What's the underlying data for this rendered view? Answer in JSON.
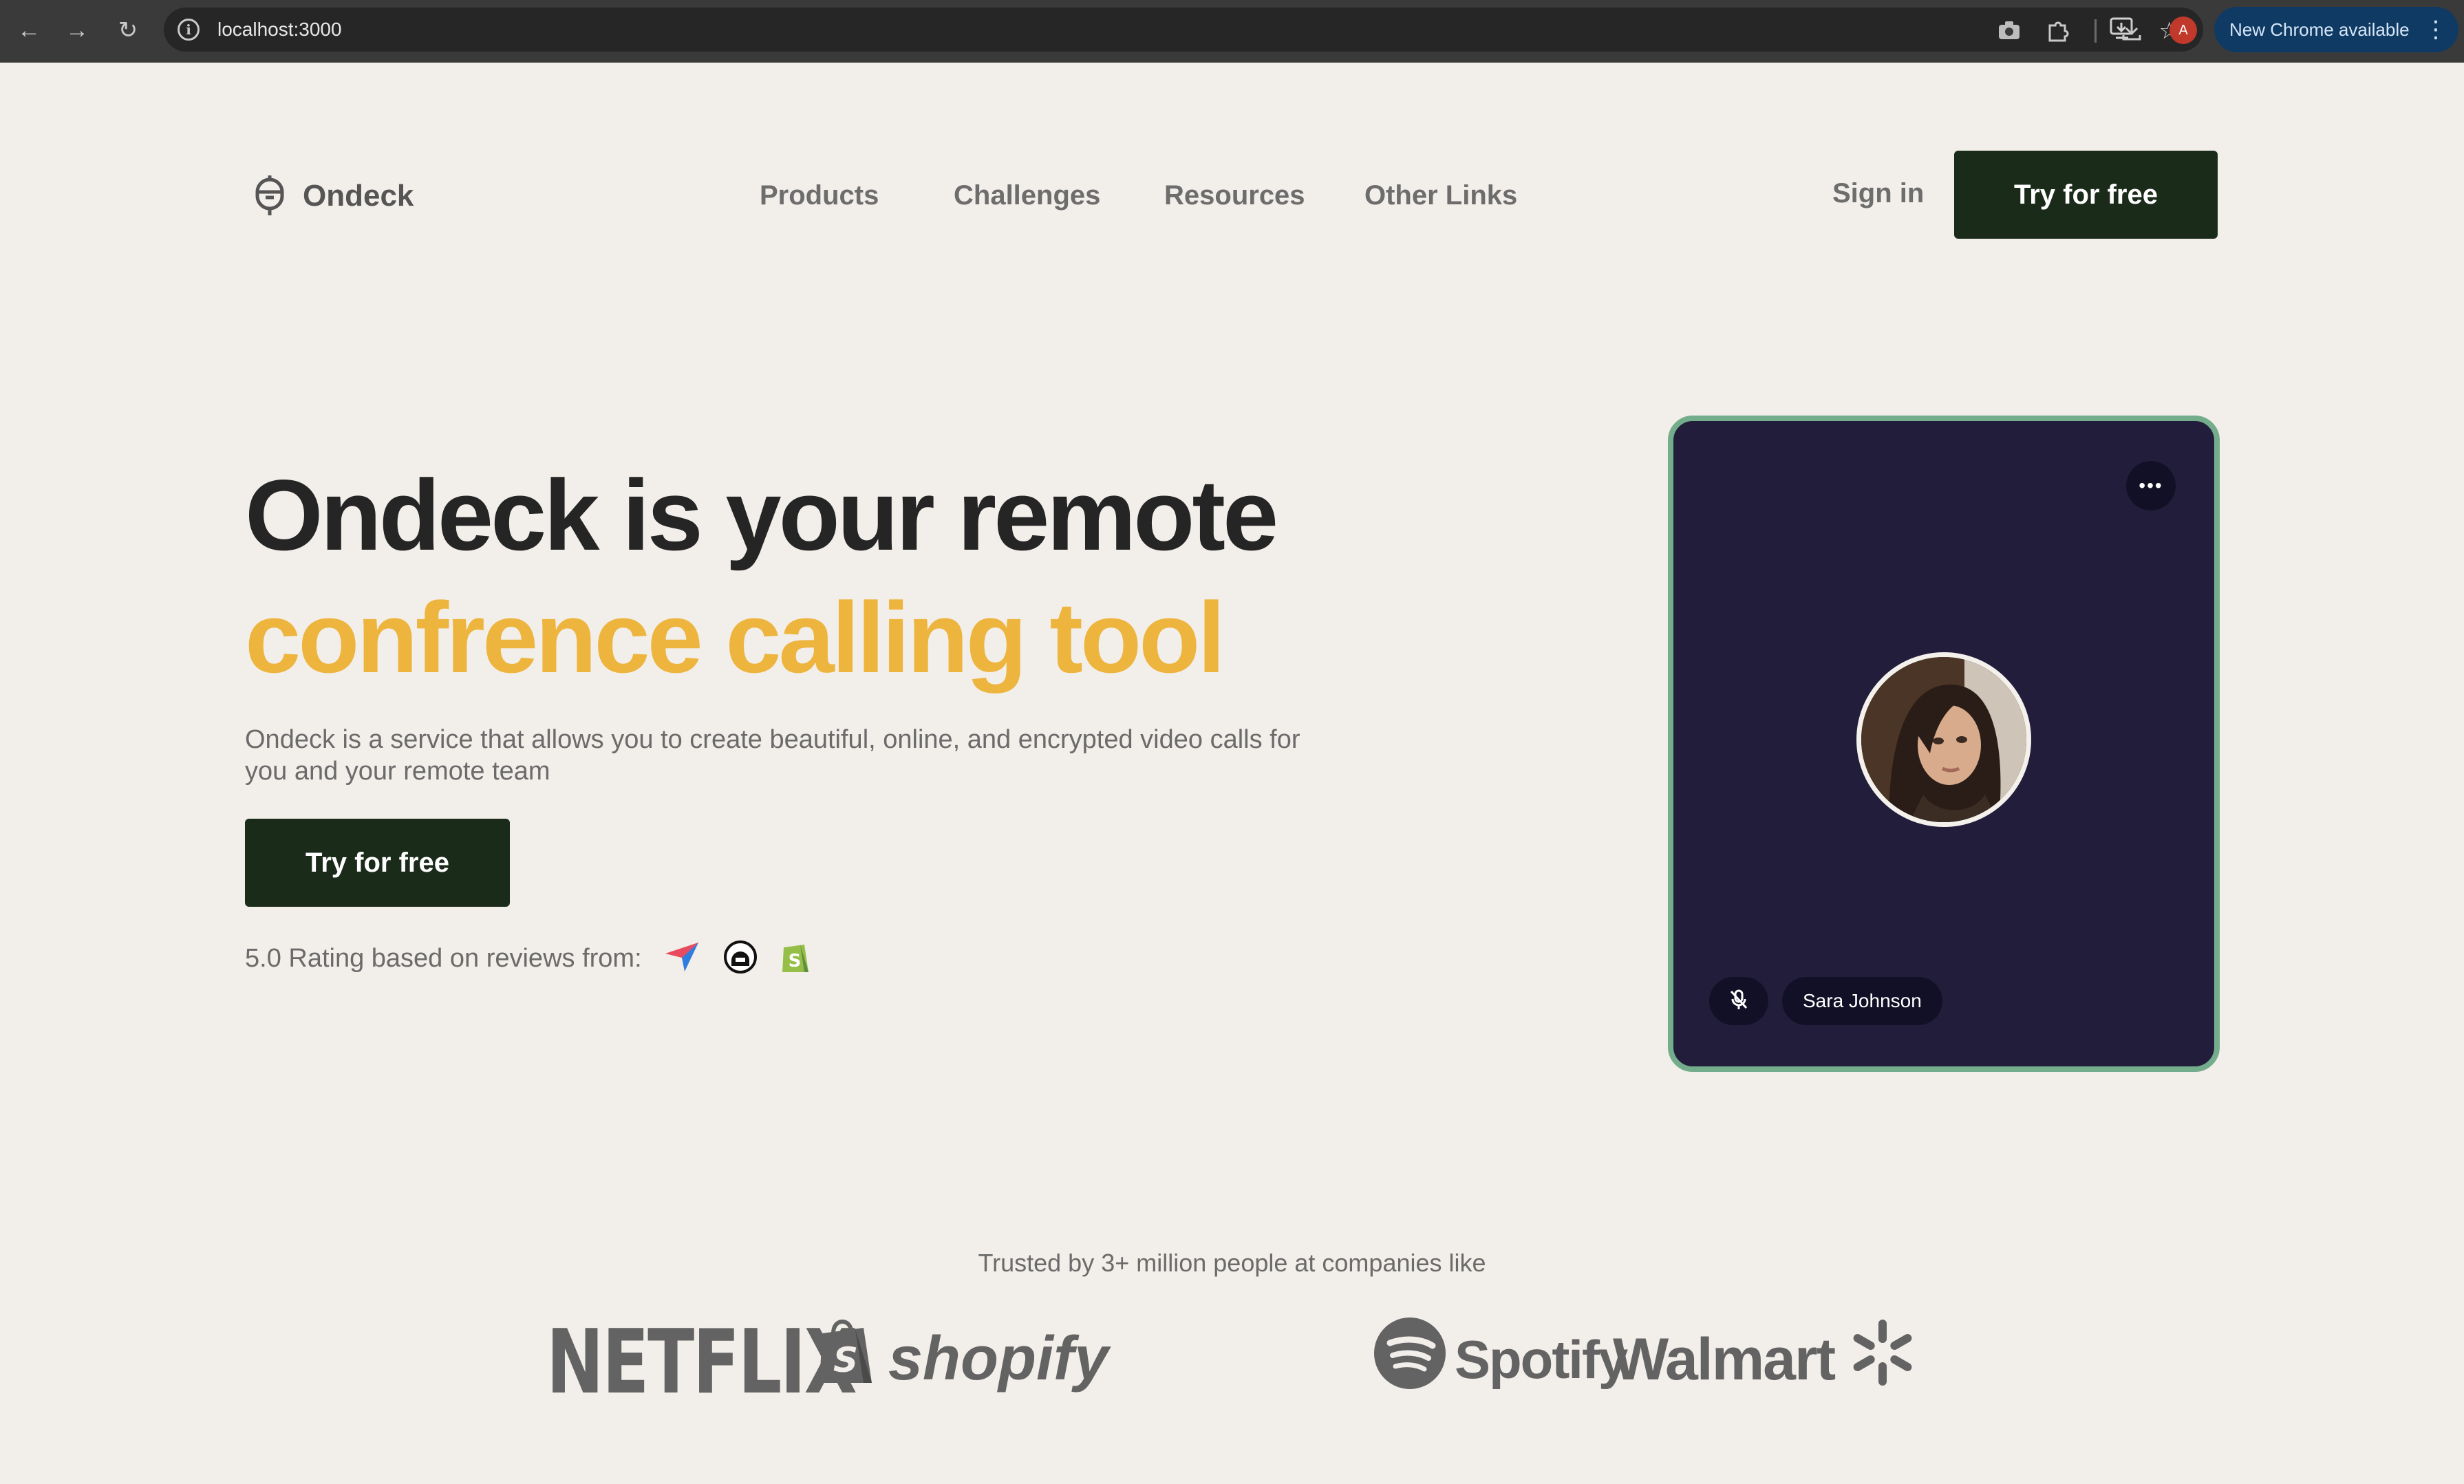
{
  "browser": {
    "url": "localhost:3000",
    "update_label": "New Chrome available",
    "profile_initial": "A"
  },
  "header": {
    "brand": "Ondeck",
    "nav": [
      "Products",
      "Challenges",
      "Resources",
      "Other Links"
    ],
    "sign_in": "Sign in",
    "cta": "Try for free"
  },
  "hero": {
    "title_line1": "Ondeck is your remote",
    "title_line2": "confrence calling tool",
    "description": "Ondeck is a service that allows you to create beautiful, online, and encrypted video calls for you and your remote team",
    "cta": "Try for free",
    "rating_text": "5.0 Rating based on reviews from:"
  },
  "call": {
    "participant": "Sara Johnson",
    "more_label": "•••"
  },
  "trusted": {
    "heading": "Trusted by 3+ million people at companies like",
    "brands": [
      "NETFLIX",
      "shopify",
      "Spotify",
      "Walmart"
    ]
  },
  "colors": {
    "accent": "#edb53e",
    "dark_button": "#1b2b1a",
    "card_bg": "#231d3c",
    "card_border": "#74ad8c",
    "page_bg": "#f2eee9"
  }
}
